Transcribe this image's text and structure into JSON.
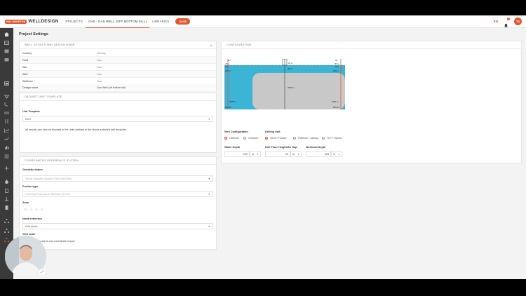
{
  "topbar": {
    "logo_badge": "HALLIBURTON",
    "logo_text": "WELLDESIGN",
    "nav": [
      {
        "label": "PROJECTS"
      },
      {
        "label": "GAS - GAS WELL (OFF BOTTOM KILL)"
      },
      {
        "label": "LIBRARIES"
      }
    ],
    "save_label": "SAVE",
    "lang": "EN",
    "notif_count": "3",
    "avatar_initials": "TS"
  },
  "page_title": "Project Settings",
  "well_details": {
    "header": "WELL DETAILS AND DESIGN NAME",
    "rows": [
      {
        "label": "Country",
        "value": "Norway"
      },
      {
        "label": "Field",
        "value": "Gas"
      },
      {
        "label": "Site",
        "value": "Gas"
      },
      {
        "label": "Well",
        "value": "Gas"
      },
      {
        "label": "Wellbore",
        "value": "Gas"
      },
      {
        "label": "Design name",
        "value": "Gas Well (off bottom kill)"
      }
    ]
  },
  "units": {
    "header": "DATASET UNIT TEMPLATE",
    "template_label": "Unit Template",
    "template_value": "NCS",
    "note": "All results can now be showed in the units defined in the above selected unit template."
  },
  "crs": {
    "header": "COORDINATES REFERENCE SYSTEM",
    "datum_label": "Geodetic datum",
    "datum_value": "World Geodetic System 1984 (WGS84)",
    "proj_label": "Portion type",
    "proj_value": "Universal Transverse Mercator (UTM)",
    "zone_label": "Zone",
    "zone_values": [
      "31",
      "V",
      "N",
      "S"
    ],
    "north_label": "North reference",
    "north_value": "Grid North",
    "grid_label": "Grid scale",
    "grid_note": "Apply grid scale to raw coordinate export"
  },
  "configuration": {
    "header": "CONFIGURATION",
    "well_config_label": "Well Configuration",
    "well_config_options": [
      "Offshore",
      "Onshore"
    ],
    "drilling_unit_label": "Drilling Unit",
    "drilling_unit_options": [
      "Semi / Floater",
      "Platform / Jackup",
      "TLP / Hybrid"
    ],
    "water_depth_label": "Water Depth",
    "water_depth_value": "200",
    "water_depth_unit": "m",
    "drill_floor_label": "Drill Floor Height/Air Gap",
    "drill_floor_value": "25",
    "drill_floor_unit": "m",
    "wellhead_label": "Wellhead Depth",
    "wellhead_value": "225",
    "wellhead_unit": "m",
    "diagram": {
      "top_left": "0m",
      "top_right": "0m",
      "rkb_left": "25 m",
      "rkb_right": "25 m",
      "rig_label": "25 m",
      "msl_left": "MSL",
      "msl_right": "MSL",
      "sea_label": "200 m",
      "wh_left": "225 m",
      "wh_right": "225 m",
      "td_center": "2575 m",
      "td_left": "2575 m",
      "td_right": "2000 m",
      "bottom_left": "MSL 0m",
      "bottom_right": "MSL 0m"
    }
  },
  "colors": {
    "accent": "#e8552e",
    "sea": "#3bb4d6",
    "formation": "#c8c8c8"
  }
}
